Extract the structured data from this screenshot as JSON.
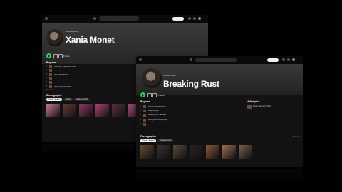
{
  "colors": {
    "accent": "#1ed760",
    "background": "#121212"
  },
  "back_window": {
    "artist": {
      "verified": "Verified Artist",
      "name": "Xania Monet",
      "listeners": ""
    },
    "follow_label": "Follow",
    "popular": {
      "heading": "Popular",
      "tracks": [
        {
          "num": "1",
          "title": "How Was I Supposed to Know",
          "plays": "",
          "duration": ""
        },
        {
          "num": "2",
          "title": "Let Go, Let God",
          "plays": "",
          "duration": ""
        },
        {
          "num": "3",
          "title": "Said I Was Leaving",
          "plays": "",
          "duration": ""
        },
        {
          "num": "4",
          "title": "Sucker for the Kills",
          "plays": "",
          "duration": ""
        },
        {
          "num": "5",
          "title": "You Know What That's Worth",
          "plays": "",
          "duration": ""
        },
        {
          "num": "6",
          "title": "Gimme Our Love Back",
          "plays": "",
          "duration": ""
        }
      ],
      "see_more": "See more"
    },
    "discography": {
      "heading": "Discography",
      "pills": [
        "Popular releases",
        "Albums",
        "Singles and EPs"
      ],
      "cards": [
        {
          "title": "",
          "sub": "",
          "color": "#c47a9a"
        },
        {
          "title": "",
          "sub": "",
          "color": "#6a3a3a"
        },
        {
          "title": "",
          "sub": "",
          "color": "#8a3a6a"
        },
        {
          "title": "",
          "sub": "",
          "color": "#b04070"
        },
        {
          "title": "",
          "sub": "",
          "color": "#5a3040"
        },
        {
          "title": "",
          "sub": "",
          "color": "#a84a7a"
        }
      ]
    }
  },
  "front_window": {
    "artist": {
      "verified": "Verified Artist",
      "name": "Breaking Rust",
      "listeners": ""
    },
    "follow_label": "Follow",
    "popular": {
      "heading": "Popular",
      "tracks": [
        {
          "num": "1",
          "title": "Livin' on Borrowed Time",
          "plays": "",
          "duration": ""
        },
        {
          "num": "2",
          "title": "Walk My Walk",
          "plays": "",
          "duration": ""
        },
        {
          "num": "3",
          "title": "Whiskey Don't Talk Back",
          "plays": "",
          "duration": ""
        },
        {
          "num": "4",
          "title": "Kicking Back at the Ridge",
          "plays": "",
          "duration": ""
        },
        {
          "num": "5",
          "title": "Sweat Don't Lie",
          "plays": "",
          "duration": ""
        }
      ]
    },
    "artist_pick": {
      "heading": "Artist pick",
      "title": "Kicking Back at the Ridge"
    },
    "discography": {
      "heading": "Discography",
      "show_all": "Show all",
      "pills": [
        "Popular releases",
        "Singles and EPs"
      ],
      "cards": [
        {
          "title": "",
          "sub": "",
          "color": "#6a4a30"
        },
        {
          "title": "",
          "sub": "",
          "color": "#3a3230"
        },
        {
          "title": "",
          "sub": "",
          "color": "#5a4a3a"
        },
        {
          "title": "",
          "sub": "",
          "color": "#2a2424"
        },
        {
          "title": "",
          "sub": "",
          "color": "#8a5a3a"
        },
        {
          "title": "",
          "sub": "",
          "color": "#a07050"
        },
        {
          "title": "",
          "sub": "",
          "color": "#7a6050"
        }
      ]
    }
  }
}
